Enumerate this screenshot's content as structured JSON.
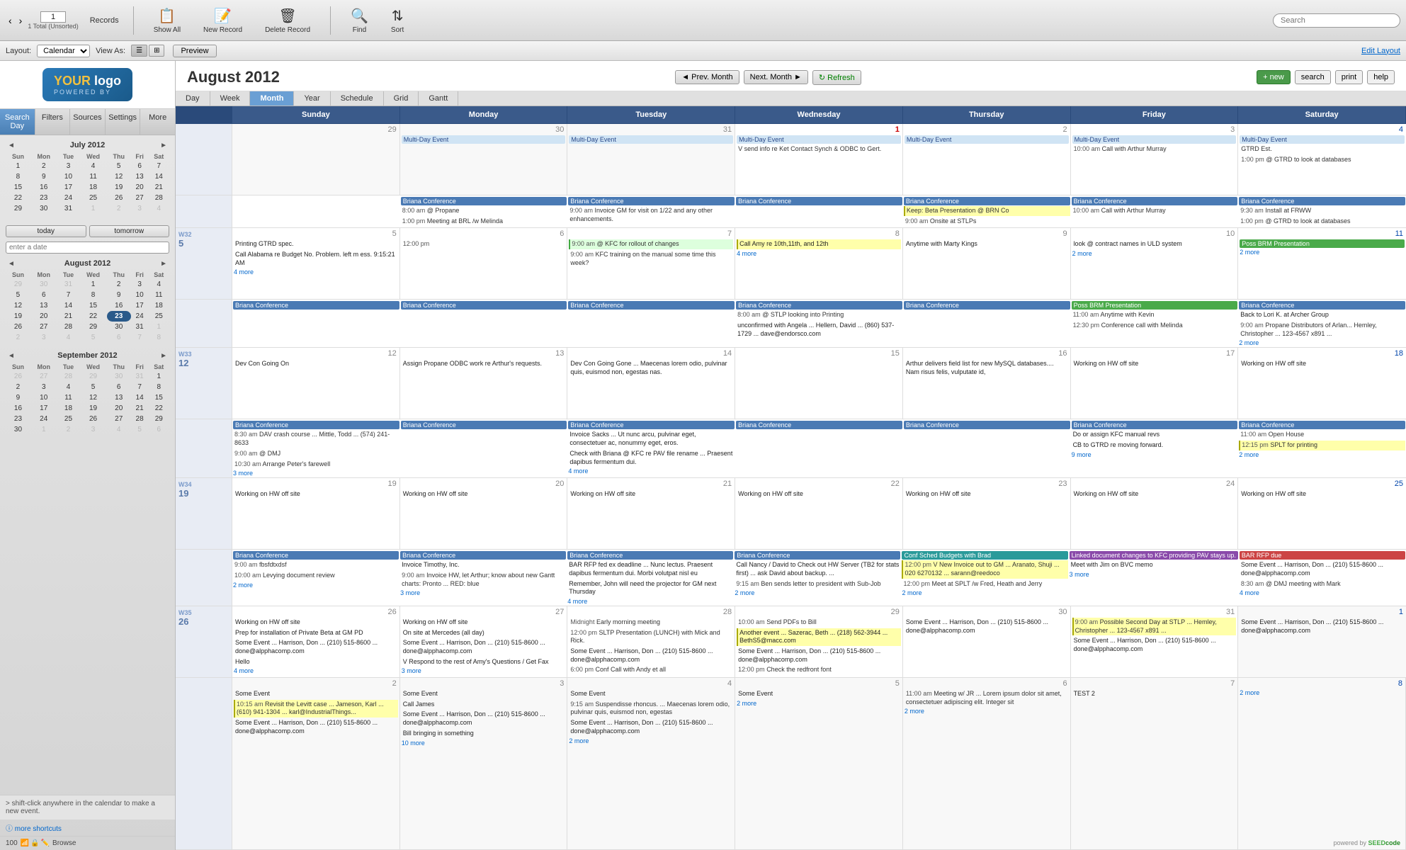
{
  "toolbar": {
    "back_btn": "‹",
    "forward_btn": "›",
    "page_num": "1",
    "total_label": "1 Total (Unsorted)",
    "records_label": "Records",
    "show_all_label": "Show All",
    "new_record_label": "New Record",
    "delete_record_label": "Delete Record",
    "find_label": "Find",
    "sort_label": "Sort",
    "search_placeholder": "Search"
  },
  "layout_bar": {
    "layout_label": "Layout:",
    "layout_value": "Calendar",
    "view_as_label": "View As:",
    "preview_label": "Preview",
    "edit_layout_label": "Edit Layout"
  },
  "sidebar": {
    "logo_text": "YOUR logo",
    "nav_tabs": [
      "Seach Day",
      "Filters",
      "Sources",
      "Settings",
      "More"
    ],
    "active_tab": "Seach Day",
    "today_btn": "today",
    "tomorrow_btn": "tomorrow",
    "enter_date_placeholder": "enter a date",
    "hint": "> shift-click anywhere in the calendar to make a new event.",
    "shortcuts_label": "ⓘ more shortcuts",
    "status_label": "Browse",
    "status_num": "100"
  },
  "mini_calendars": [
    {
      "month": "July 2012",
      "days_header": [
        "Sun",
        "Mon",
        "Tue",
        "Wed",
        "Thu",
        "Fri",
        "Sat"
      ],
      "weeks": [
        [
          {
            "d": "1",
            "m": 0
          },
          {
            "d": "2",
            "m": 0
          },
          {
            "d": "3",
            "m": 0
          },
          {
            "d": "4",
            "m": 0
          },
          {
            "d": "5",
            "m": 0
          },
          {
            "d": "6",
            "m": 0
          },
          {
            "d": "7",
            "m": 0
          }
        ],
        [
          {
            "d": "8",
            "m": 0
          },
          {
            "d": "9",
            "m": 0
          },
          {
            "d": "10",
            "m": 0
          },
          {
            "d": "11",
            "m": 0
          },
          {
            "d": "12",
            "m": 0
          },
          {
            "d": "13",
            "m": 0
          },
          {
            "d": "14",
            "m": 0
          }
        ],
        [
          {
            "d": "15",
            "m": 0
          },
          {
            "d": "16",
            "m": 0
          },
          {
            "d": "17",
            "m": 0
          },
          {
            "d": "18",
            "m": 0
          },
          {
            "d": "19",
            "m": 0
          },
          {
            "d": "20",
            "m": 0
          },
          {
            "d": "21",
            "m": 0
          }
        ],
        [
          {
            "d": "22",
            "m": 0
          },
          {
            "d": "23",
            "m": 0
          },
          {
            "d": "24",
            "m": 0
          },
          {
            "d": "25",
            "m": 0
          },
          {
            "d": "26",
            "m": 0
          },
          {
            "d": "27",
            "m": 0
          },
          {
            "d": "28",
            "m": 0
          }
        ],
        [
          {
            "d": "29",
            "m": 0
          },
          {
            "d": "30",
            "m": 0
          },
          {
            "d": "31",
            "m": 0
          },
          {
            "d": "1",
            "m": 1
          },
          {
            "d": "2",
            "m": 1
          },
          {
            "d": "3",
            "m": 1
          },
          {
            "d": "4",
            "m": 1
          }
        ]
      ]
    },
    {
      "month": "August 2012",
      "days_header": [
        "Sun",
        "Mon",
        "Tue",
        "Wed",
        "Thu",
        "Fri",
        "Sat"
      ],
      "weeks": [
        [
          {
            "d": "29",
            "m": 1
          },
          {
            "d": "30",
            "m": 1
          },
          {
            "d": "31",
            "m": 1
          },
          {
            "d": "1",
            "m": 0
          },
          {
            "d": "2",
            "m": 0
          },
          {
            "d": "3",
            "m": 0
          },
          {
            "d": "4",
            "m": 0
          }
        ],
        [
          {
            "d": "5",
            "m": 0
          },
          {
            "d": "6",
            "m": 0
          },
          {
            "d": "7",
            "m": 0
          },
          {
            "d": "8",
            "m": 0
          },
          {
            "d": "9",
            "m": 0
          },
          {
            "d": "10",
            "m": 0
          },
          {
            "d": "11",
            "m": 0
          }
        ],
        [
          {
            "d": "12",
            "m": 0
          },
          {
            "d": "13",
            "m": 0
          },
          {
            "d": "14",
            "m": 0
          },
          {
            "d": "15",
            "m": 0
          },
          {
            "d": "16",
            "m": 0
          },
          {
            "d": "17",
            "m": 0
          },
          {
            "d": "18",
            "m": 0
          }
        ],
        [
          {
            "d": "19",
            "m": 0
          },
          {
            "d": "20",
            "m": 0
          },
          {
            "d": "21",
            "m": 0
          },
          {
            "d": "22",
            "m": 0
          },
          {
            "d": "23",
            "m": 0,
            "sel": true
          },
          {
            "d": "24",
            "m": 0
          },
          {
            "d": "25",
            "m": 0
          }
        ],
        [
          {
            "d": "26",
            "m": 0
          },
          {
            "d": "27",
            "m": 0
          },
          {
            "d": "28",
            "m": 0
          },
          {
            "d": "29",
            "m": 0
          },
          {
            "d": "30",
            "m": 0
          },
          {
            "d": "31",
            "m": 0
          },
          {
            "d": "1",
            "m": 1
          }
        ],
        [
          {
            "d": "2",
            "m": 1
          },
          {
            "d": "3",
            "m": 1
          },
          {
            "d": "4",
            "m": 1
          },
          {
            "d": "5",
            "m": 1
          },
          {
            "d": "6",
            "m": 1
          },
          {
            "d": "7",
            "m": 1
          },
          {
            "d": "8",
            "m": 1
          }
        ]
      ]
    },
    {
      "month": "September 2012",
      "days_header": [
        "Sun",
        "Mon",
        "Tue",
        "Wed",
        "Thu",
        "Fri",
        "Sat"
      ],
      "weeks": [
        [
          {
            "d": "26",
            "m": 1
          },
          {
            "d": "27",
            "m": 1
          },
          {
            "d": "28",
            "m": 1
          },
          {
            "d": "29",
            "m": 1
          },
          {
            "d": "30",
            "m": 1
          },
          {
            "d": "31",
            "m": 1
          },
          {
            "d": "1",
            "m": 0
          }
        ],
        [
          {
            "d": "2",
            "m": 0
          },
          {
            "d": "3",
            "m": 0
          },
          {
            "d": "4",
            "m": 0
          },
          {
            "d": "5",
            "m": 0
          },
          {
            "d": "6",
            "m": 0
          },
          {
            "d": "7",
            "m": 0
          },
          {
            "d": "8",
            "m": 0
          }
        ],
        [
          {
            "d": "9",
            "m": 0
          },
          {
            "d": "10",
            "m": 0
          },
          {
            "d": "11",
            "m": 0
          },
          {
            "d": "12",
            "m": 0
          },
          {
            "d": "13",
            "m": 0
          },
          {
            "d": "14",
            "m": 0
          },
          {
            "d": "15",
            "m": 0
          }
        ],
        [
          {
            "d": "16",
            "m": 0
          },
          {
            "d": "17",
            "m": 0
          },
          {
            "d": "18",
            "m": 0
          },
          {
            "d": "19",
            "m": 0
          },
          {
            "d": "20",
            "m": 0
          },
          {
            "d": "21",
            "m": 0
          },
          {
            "d": "22",
            "m": 0
          }
        ],
        [
          {
            "d": "23",
            "m": 0
          },
          {
            "d": "24",
            "m": 0
          },
          {
            "d": "25",
            "m": 0
          },
          {
            "d": "26",
            "m": 0
          },
          {
            "d": "27",
            "m": 0
          },
          {
            "d": "28",
            "m": 0
          },
          {
            "d": "29",
            "m": 0
          }
        ],
        [
          {
            "d": "30",
            "m": 0
          },
          {
            "d": "1",
            "m": 1
          },
          {
            "d": "2",
            "m": 1
          },
          {
            "d": "3",
            "m": 1
          },
          {
            "d": "4",
            "m": 1
          },
          {
            "d": "5",
            "m": 1
          },
          {
            "d": "6",
            "m": 1
          }
        ]
      ]
    }
  ],
  "calendar": {
    "title": "August 2012",
    "nav_btns": [
      "◄ Prev. Month",
      "Next. Month ►",
      "↻ Refresh"
    ],
    "view_tabs": [
      "Day",
      "Week",
      "Month",
      "Year",
      "Schedule",
      "Grid",
      "Gantt"
    ],
    "active_view": "Month",
    "action_btns": [
      "+ new",
      "search",
      "print",
      "help"
    ],
    "day_headers": [
      "Sunday",
      "Monday",
      "Tuesday",
      "Wednesday",
      "Thursday",
      "Friday",
      "Saturday"
    ]
  }
}
